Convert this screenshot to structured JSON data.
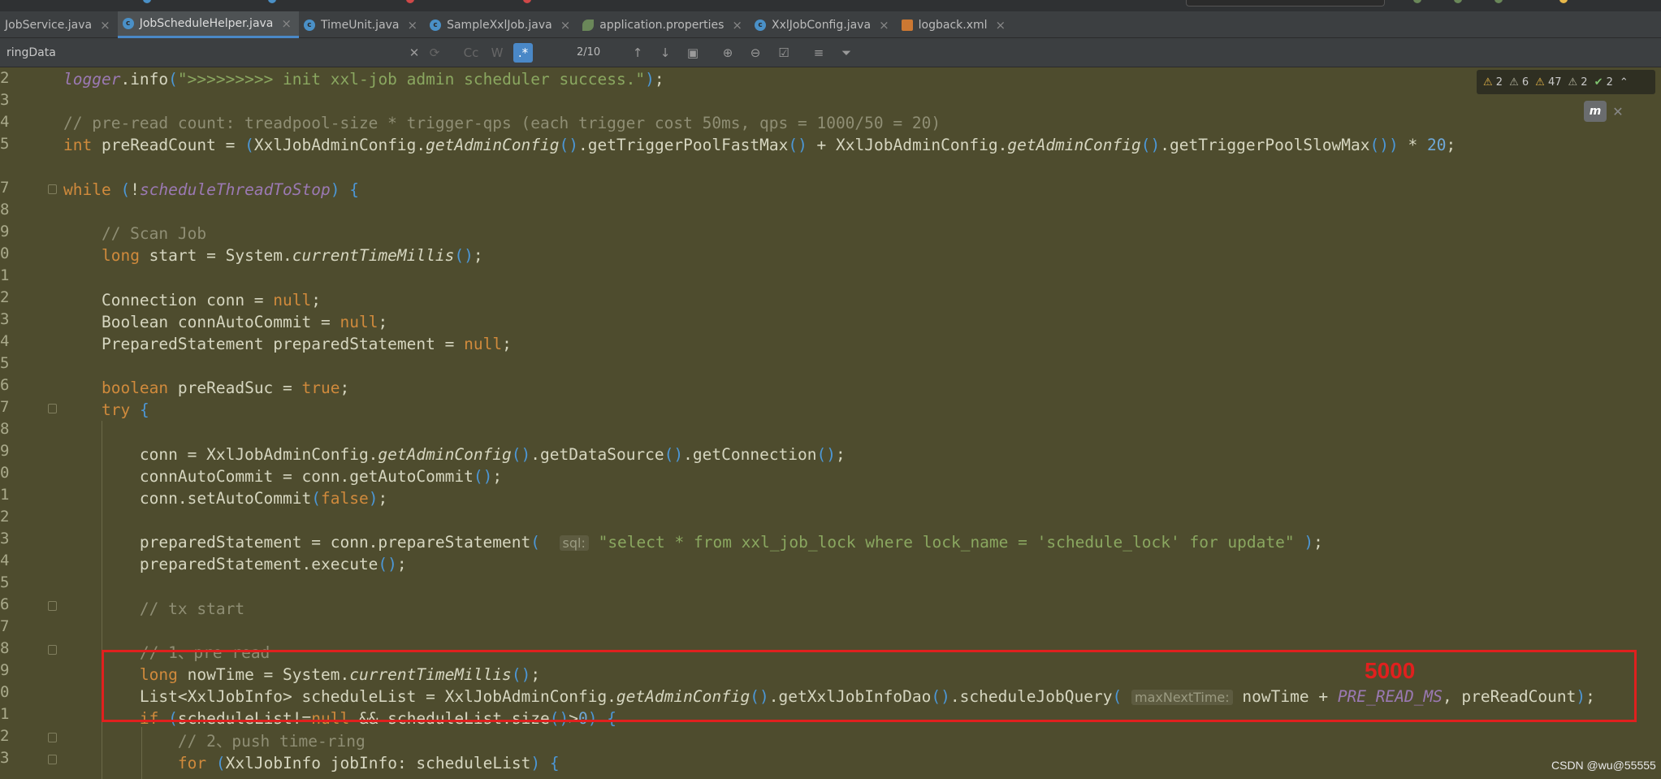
{
  "tabs": [
    {
      "label": "JobService.java",
      "icon": "none",
      "active": false
    },
    {
      "label": "JobScheduleHelper.java",
      "icon": "java-class",
      "active": true
    },
    {
      "label": "TimeUnit.java",
      "icon": "java-class",
      "active": false
    },
    {
      "label": "SampleXxlJob.java",
      "icon": "java-class",
      "active": false
    },
    {
      "label": "application.properties",
      "icon": "spring-leaf",
      "active": false
    },
    {
      "label": "XxlJobConfig.java",
      "icon": "java-class",
      "active": false
    },
    {
      "label": "logback.xml",
      "icon": "xml-file",
      "active": false
    }
  ],
  "find": {
    "query": "ringData",
    "match_count": "2/10",
    "match_case_label": "Cc",
    "words_label": "W",
    "regex_label": ".*"
  },
  "line_numbers": [
    "2",
    "3",
    "4",
    "5",
    "",
    "7",
    "8",
    "9",
    "0",
    "1",
    "2",
    "3",
    "4",
    "5",
    "6",
    "7",
    "8",
    "9",
    "0",
    "1",
    "2",
    "3",
    "4",
    "5",
    "6",
    "7",
    "8",
    "9",
    "0",
    "1",
    "2",
    "3"
  ],
  "code_lines": [
    "logger.info(\">>>>>>>>> init xxl-job admin scheduler success.\");",
    "",
    "// pre-read count: treadpool-size * trigger-qps (each trigger cost 50ms, qps = 1000/50 = 20)",
    "int preReadCount = (XxlJobAdminConfig.getAdminConfig().getTriggerPoolFastMax() + XxlJobAdminConfig.getAdminConfig().getTriggerPoolSlowMax()) * 20;",
    "",
    "while (!scheduleThreadToStop) {",
    "",
    "    // Scan Job",
    "    long start = System.currentTimeMillis();",
    "",
    "    Connection conn = null;",
    "    Boolean connAutoCommit = null;",
    "    PreparedStatement preparedStatement = null;",
    "",
    "    boolean preReadSuc = true;",
    "    try {",
    "",
    "        conn = XxlJobAdminConfig.getAdminConfig().getDataSource().getConnection();",
    "        connAutoCommit = conn.getAutoCommit();",
    "        conn.setAutoCommit(false);",
    "",
    "        preparedStatement = conn.prepareStatement(  sql: \"select * from xxl_job_lock where lock_name = 'schedule_lock' for update\" );",
    "        preparedStatement.execute();",
    "",
    "        // tx start",
    "",
    "        // 1、pre read",
    "        long nowTime = System.currentTimeMillis();",
    "        List<XxlJobInfo> scheduleList = XxlJobAdminConfig.getAdminConfig().getXxlJobInfoDao().scheduleJobQuery( maxNextTime: nowTime + PRE_READ_MS, preReadCount);",
    "        if (scheduleList!=null && scheduleList.size()>0) {",
    "            // 2、push time-ring",
    "            for (XxlJobInfo jobInfo: scheduleList) {"
  ],
  "inspections": {
    "errors": "2",
    "warnings": "6",
    "weak_warnings": "47",
    "typos": "2",
    "ok": "2"
  },
  "annotation": {
    "label": "5000",
    "color": "#e0201e"
  },
  "watermark": "CSDN @wu@55555",
  "colors": {
    "editor_bg": "#4e4c2e",
    "keyword": "#d08a3c",
    "comment": "#8f8e74",
    "string": "#8aa760",
    "accent": "#4a88c7"
  }
}
